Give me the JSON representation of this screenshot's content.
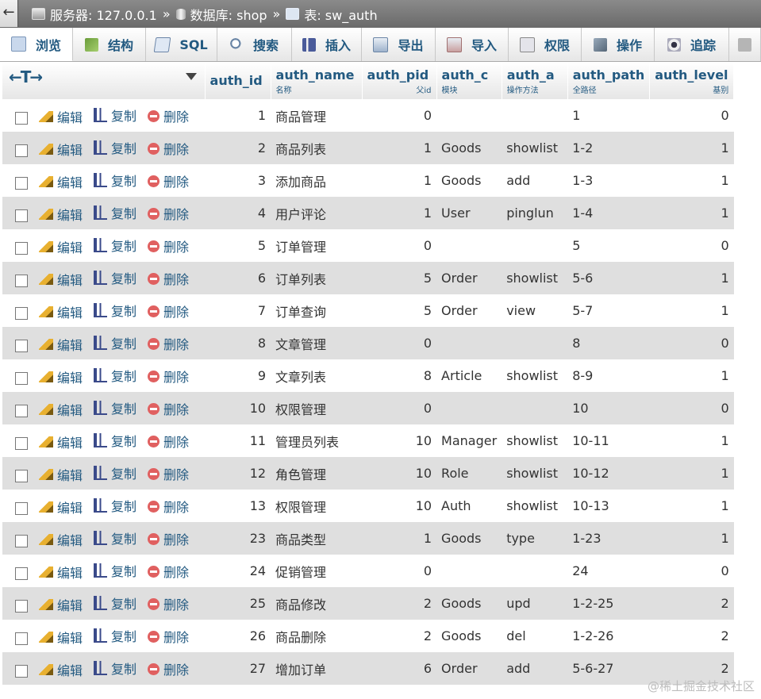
{
  "breadcrumb": {
    "back": "←",
    "server_label": "服务器: 127.0.0.1",
    "sep1": "»",
    "db_label": "数据库: shop",
    "sep2": "»",
    "table_label": "表: sw_auth"
  },
  "tabs": [
    {
      "label": "浏览",
      "icon": "browse-icon",
      "active": true
    },
    {
      "label": "结构",
      "icon": "structure-icon"
    },
    {
      "label": "SQL",
      "icon": "sql-icon"
    },
    {
      "label": "搜索",
      "icon": "search-icon"
    },
    {
      "label": "插入",
      "icon": "insert-icon"
    },
    {
      "label": "导出",
      "icon": "export-icon"
    },
    {
      "label": "导入",
      "icon": "import-icon"
    },
    {
      "label": "权限",
      "icon": "privileges-icon"
    },
    {
      "label": "操作",
      "icon": "operations-icon"
    },
    {
      "label": "追踪",
      "icon": "tracking-icon"
    }
  ],
  "columns": [
    {
      "name": "auth_id",
      "comment": ""
    },
    {
      "name": "auth_name",
      "comment": "名称"
    },
    {
      "name": "auth_pid",
      "comment": "父id"
    },
    {
      "name": "auth_c",
      "comment": "模块"
    },
    {
      "name": "auth_a",
      "comment": "操作方法"
    },
    {
      "name": "auth_path",
      "comment": "全路径"
    },
    {
      "name": "auth_level",
      "comment": "基别"
    }
  ],
  "actions": {
    "edit": "编辑",
    "copy": "复制",
    "delete": "删除"
  },
  "rows": [
    [
      "1",
      "商品管理",
      "0",
      "",
      "",
      "1",
      "0"
    ],
    [
      "2",
      "商品列表",
      "1",
      "Goods",
      "showlist",
      "1-2",
      "1"
    ],
    [
      "3",
      "添加商品",
      "1",
      "Goods",
      "add",
      "1-3",
      "1"
    ],
    [
      "4",
      "用户评论",
      "1",
      "User",
      "pinglun",
      "1-4",
      "1"
    ],
    [
      "5",
      "订单管理",
      "0",
      "",
      "",
      "5",
      "0"
    ],
    [
      "6",
      "订单列表",
      "5",
      "Order",
      "showlist",
      "5-6",
      "1"
    ],
    [
      "7",
      "订单查询",
      "5",
      "Order",
      "view",
      "5-7",
      "1"
    ],
    [
      "8",
      "文章管理",
      "0",
      "",
      "",
      "8",
      "0"
    ],
    [
      "9",
      "文章列表",
      "8",
      "Article",
      "showlist",
      "8-9",
      "1"
    ],
    [
      "10",
      "权限管理",
      "0",
      "",
      "",
      "10",
      "0"
    ],
    [
      "11",
      "管理员列表",
      "10",
      "Manager",
      "showlist",
      "10-11",
      "1"
    ],
    [
      "12",
      "角色管理",
      "10",
      "Role",
      "showlist",
      "10-12",
      "1"
    ],
    [
      "13",
      "权限管理",
      "10",
      "Auth",
      "showlist",
      "10-13",
      "1"
    ],
    [
      "23",
      "商品类型",
      "1",
      "Goods",
      "type",
      "1-23",
      "1"
    ],
    [
      "24",
      "促销管理",
      "0",
      "",
      "",
      "24",
      "0"
    ],
    [
      "25",
      "商品修改",
      "2",
      "Goods",
      "upd",
      "1-2-25",
      "2"
    ],
    [
      "26",
      "商品删除",
      "2",
      "Goods",
      "del",
      "1-2-26",
      "2"
    ],
    [
      "27",
      "增加订单",
      "6",
      "Order",
      "add",
      "5-6-27",
      "2"
    ]
  ],
  "watermark": "@稀土掘金技术社区",
  "colors": {
    "link": "#235a81",
    "row_alt": "#dfdfdf",
    "topbar": "#7a7a7a"
  }
}
